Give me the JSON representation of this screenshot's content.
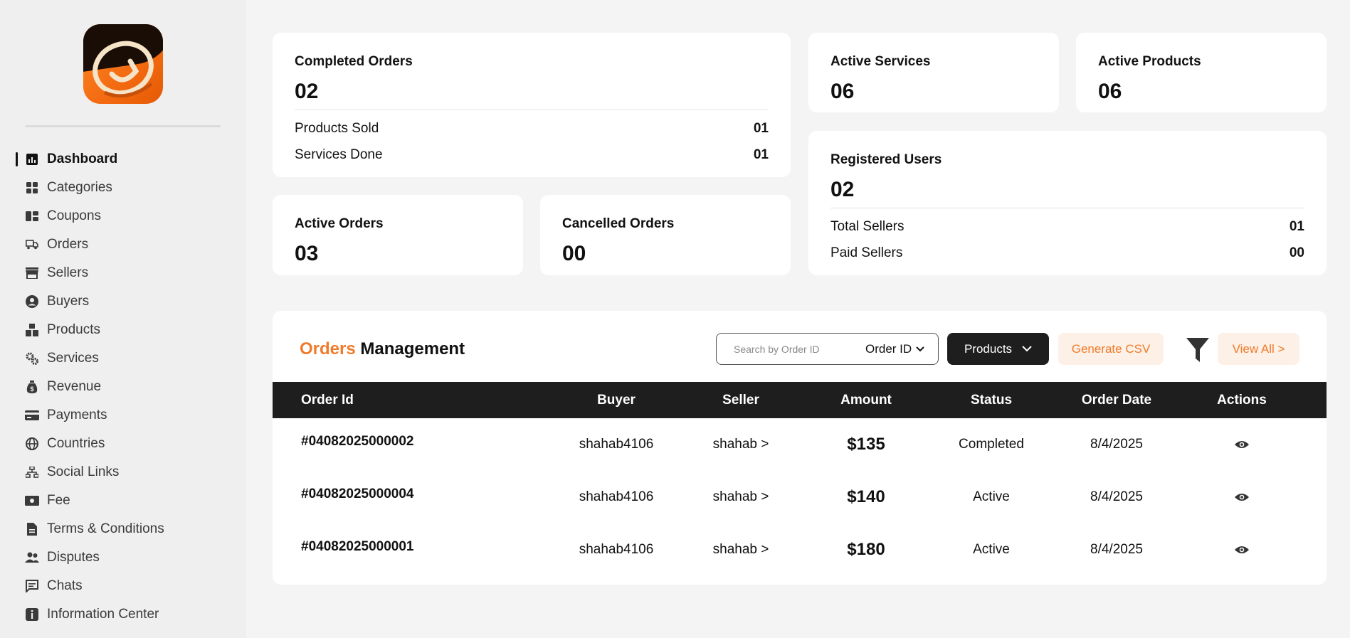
{
  "sidebar": {
    "items": [
      {
        "label": "Dashboard",
        "icon": "dashboard-icon",
        "active": true
      },
      {
        "label": "Categories",
        "icon": "categories-icon"
      },
      {
        "label": "Coupons",
        "icon": "coupon-icon"
      },
      {
        "label": "Orders",
        "icon": "truck-icon"
      },
      {
        "label": "Sellers",
        "icon": "store-icon"
      },
      {
        "label": "Buyers",
        "icon": "user-circle-icon"
      },
      {
        "label": "Products",
        "icon": "boxes-icon"
      },
      {
        "label": "Services",
        "icon": "gears-icon"
      },
      {
        "label": "Revenue",
        "icon": "money-bag-icon"
      },
      {
        "label": "Payments",
        "icon": "credit-card-icon"
      },
      {
        "label": "Countries",
        "icon": "globe-icon"
      },
      {
        "label": "Social Links",
        "icon": "network-icon"
      },
      {
        "label": "Fee",
        "icon": "cash-icon"
      },
      {
        "label": "Terms & Conditions",
        "icon": "document-icon"
      },
      {
        "label": "Disputes",
        "icon": "users-icon"
      },
      {
        "label": "Chats",
        "icon": "chat-icon"
      },
      {
        "label": "Information Center",
        "icon": "info-icon"
      }
    ]
  },
  "stats": {
    "completed": {
      "title": "Completed Orders",
      "value": "02",
      "products_label": "Products Sold",
      "products_value": "01",
      "services_label": "Services Done",
      "services_value": "01"
    },
    "active_services": {
      "title": "Active Services",
      "value": "06"
    },
    "active_products": {
      "title": "Active Products",
      "value": "06"
    },
    "active_orders": {
      "title": "Active Orders",
      "value": "03"
    },
    "cancelled_orders": {
      "title": "Cancelled Orders",
      "value": "00"
    },
    "registered_users": {
      "title": "Registered Users",
      "value": "02",
      "sellers_label": "Total Sellers",
      "sellers_value": "01",
      "paid_label": "Paid Sellers",
      "paid_value": "00"
    }
  },
  "orders": {
    "title_accent": "Orders",
    "title_rest": " Management",
    "search_placeholder": "Search by Order ID",
    "search_by": "Order ID",
    "type_filter": "Products",
    "csv_label": "Generate CSV",
    "view_all_label": "View All >",
    "columns": [
      "Order Id",
      "Buyer",
      "Seller",
      "Amount",
      "Status",
      "Order Date",
      "Actions"
    ],
    "rows": [
      {
        "id": "#04082025000002",
        "buyer": "shahab4106",
        "seller": "shahab >",
        "amount": "$135",
        "status": "Completed",
        "date": "8/4/2025"
      },
      {
        "id": "#04082025000004",
        "buyer": "shahab4106",
        "seller": "shahab >",
        "amount": "$140",
        "status": "Active",
        "date": "8/4/2025"
      },
      {
        "id": "#04082025000001",
        "buyer": "shahab4106",
        "seller": "shahab >",
        "amount": "$180",
        "status": "Active",
        "date": "8/4/2025"
      }
    ]
  },
  "colors": {
    "accent": "#f07b2b",
    "dark": "#1e1e1e",
    "accent_soft": "#fdf0e6"
  }
}
